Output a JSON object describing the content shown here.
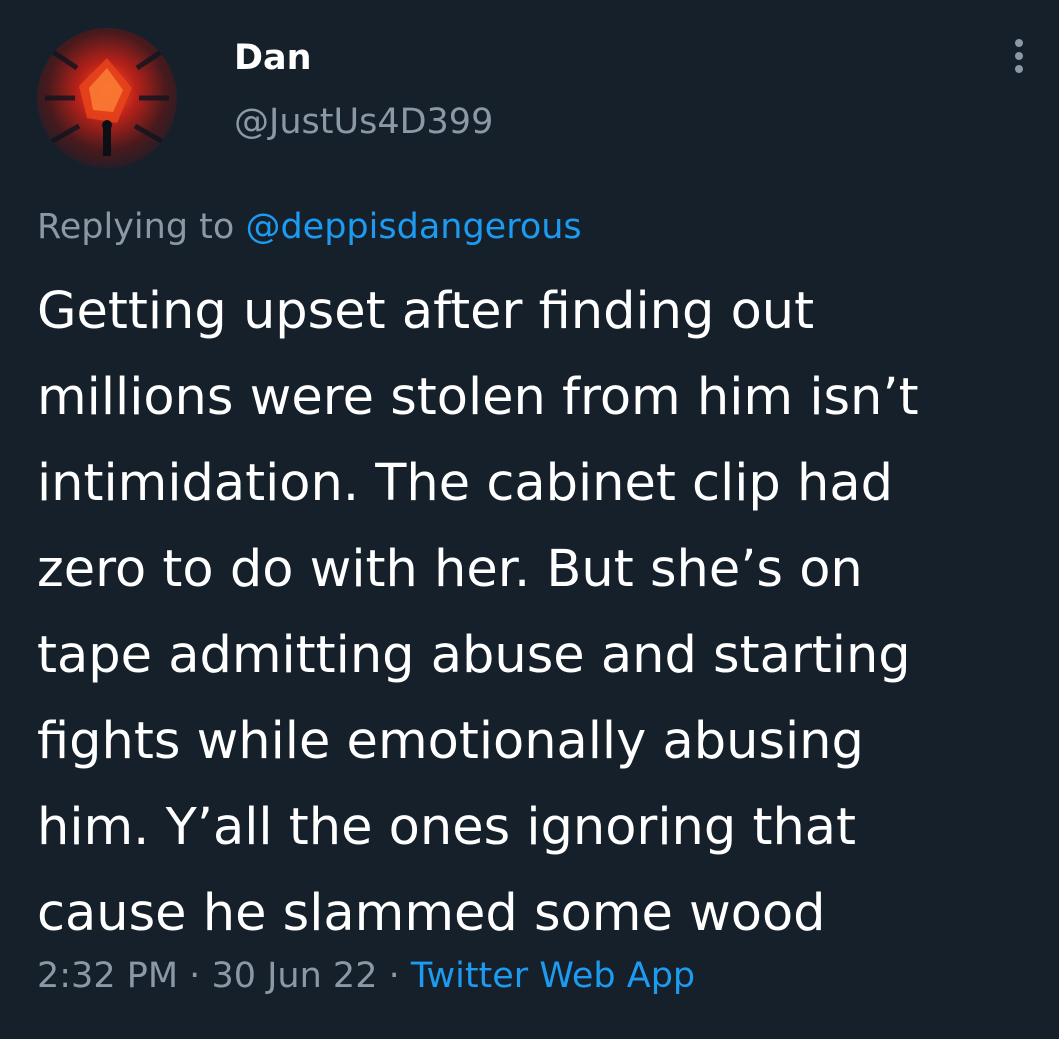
{
  "author": {
    "display_name": "Dan",
    "handle": "@JustUs4D399",
    "avatar_icon": "avatar-image"
  },
  "more_icon": "more-vertical-icon",
  "reply": {
    "prefix": "Replying to",
    "mention": "@deppisdangerous"
  },
  "tweet": {
    "lines": [
      "Getting upset after finding out",
      "millions were stolen from him isn’t",
      "intimidation. The cabinet clip had",
      "zero to do with her. But she’s on",
      "tape admitting abuse and starting",
      "fights while emotionally abusing",
      "him. Y’all the ones ignoring that",
      "cause he slammed some wood"
    ]
  },
  "meta": {
    "time": "2:32 PM",
    "separator": "·",
    "date": "30 Jun 22",
    "source": "Twitter Web App"
  },
  "colors": {
    "background": "#15202b",
    "text": "#ffffff",
    "secondary": "#8b98a5",
    "accent": "#1d9bf0"
  }
}
